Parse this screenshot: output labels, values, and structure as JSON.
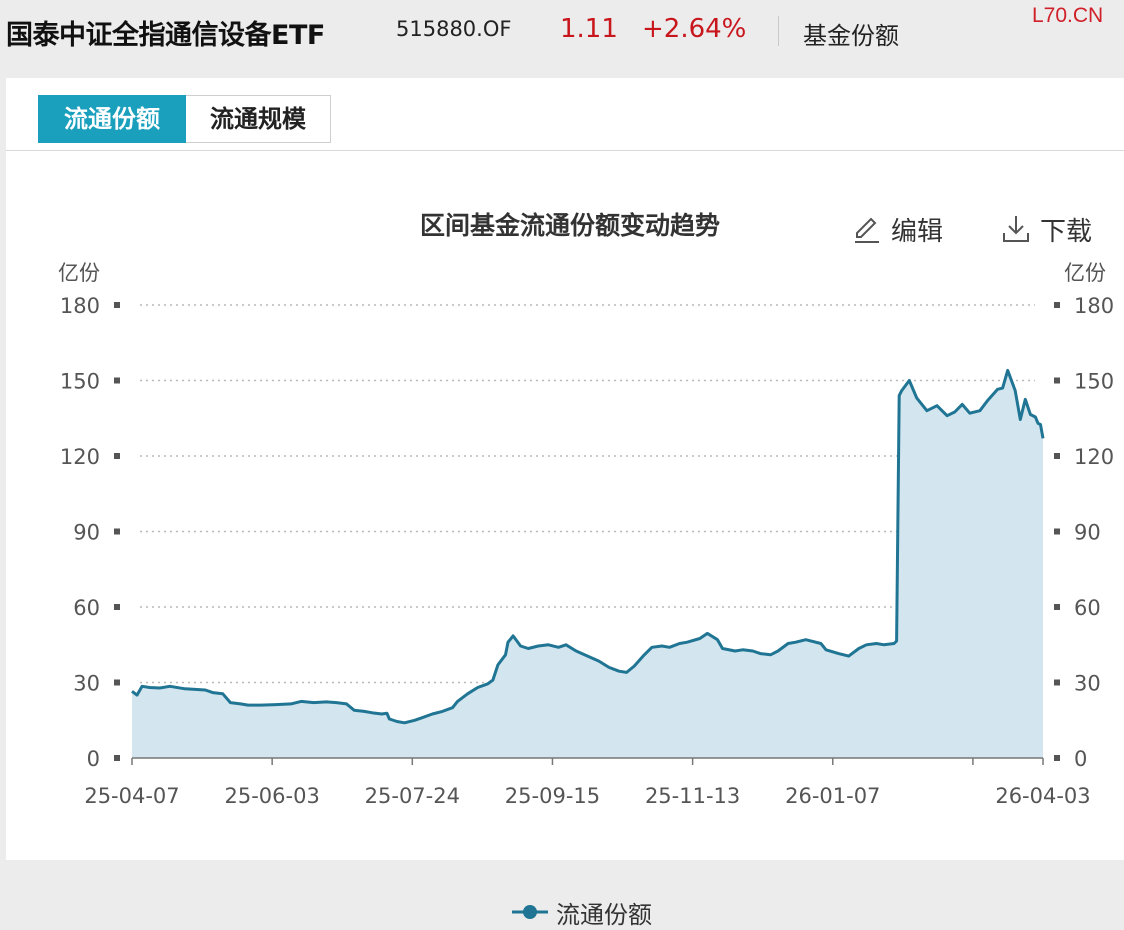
{
  "header": {
    "fund_name": "国泰中证全指通信设备ETF",
    "fund_code": "515880.OF",
    "price": "1.11",
    "change_pct": "+2.64%",
    "section": "基金份额",
    "watermark": "L70.CN"
  },
  "tabs": [
    {
      "label": "流通份额",
      "active": true
    },
    {
      "label": "流通规模",
      "active": false
    }
  ],
  "toolbar": {
    "edit_label": "编辑",
    "download_label": "下载"
  },
  "colors": {
    "line": "#1f7593",
    "area": "#d3e5ee",
    "accent": "#1a9fbd",
    "negative_red": "#c8161d"
  },
  "chart_data": {
    "type": "area",
    "title": "区间基金流通份额变动趋势",
    "y_unit_left": "亿份",
    "y_unit_right": "亿份",
    "ylim": [
      0,
      180
    ],
    "yticks": [
      0,
      30,
      60,
      90,
      120,
      150,
      180
    ],
    "xticks": [
      "25-04-07",
      "25-06-03",
      "25-07-24",
      "25-09-15",
      "25-11-13",
      "26-01-07",
      "26-04-03"
    ],
    "grid": true,
    "legend_position": "bottom-center",
    "series": [
      {
        "name": "流通份额",
        "points": [
          [
            "2025-04-07",
            26.5
          ],
          [
            "2025-04-09",
            25.0
          ],
          [
            "2025-04-11",
            28.5
          ],
          [
            "2025-04-14",
            28.0
          ],
          [
            "2025-04-18",
            27.8
          ],
          [
            "2025-04-22",
            28.5
          ],
          [
            "2025-04-28",
            27.5
          ],
          [
            "2025-05-06",
            27.0
          ],
          [
            "2025-05-09",
            26.0
          ],
          [
            "2025-05-13",
            25.5
          ],
          [
            "2025-05-16",
            22.0
          ],
          [
            "2025-05-20",
            21.5
          ],
          [
            "2025-05-23",
            21.0
          ],
          [
            "2025-05-28",
            21.0
          ],
          [
            "2025-06-03",
            21.2
          ],
          [
            "2025-06-09",
            21.5
          ],
          [
            "2025-06-13",
            22.5
          ],
          [
            "2025-06-18",
            22.0
          ],
          [
            "2025-06-23",
            22.3
          ],
          [
            "2025-06-27",
            22.0
          ],
          [
            "2025-07-01",
            21.5
          ],
          [
            "2025-07-04",
            19.0
          ],
          [
            "2025-07-08",
            18.5
          ],
          [
            "2025-07-11",
            18.0
          ],
          [
            "2025-07-15",
            17.5
          ],
          [
            "2025-07-17",
            17.8
          ],
          [
            "2025-07-18",
            15.5
          ],
          [
            "2025-07-21",
            14.5
          ],
          [
            "2025-07-24",
            14.0
          ],
          [
            "2025-07-28",
            15.0
          ],
          [
            "2025-07-31",
            16.0
          ],
          [
            "2025-08-04",
            17.5
          ],
          [
            "2025-08-08",
            18.5
          ],
          [
            "2025-08-12",
            20.0
          ],
          [
            "2025-08-14",
            22.5
          ],
          [
            "2025-08-18",
            25.5
          ],
          [
            "2025-08-22",
            28.0
          ],
          [
            "2025-08-26",
            29.5
          ],
          [
            "2025-08-28",
            31.0
          ],
          [
            "2025-08-30",
            37.0
          ],
          [
            "2025-09-02",
            41.0
          ],
          [
            "2025-09-03",
            46.0
          ],
          [
            "2025-09-05",
            48.5
          ],
          [
            "2025-09-08",
            44.5
          ],
          [
            "2025-09-11",
            43.5
          ],
          [
            "2025-09-15",
            44.5
          ],
          [
            "2025-09-19",
            45.0
          ],
          [
            "2025-09-23",
            44.0
          ],
          [
            "2025-09-26",
            45.0
          ],
          [
            "2025-09-30",
            42.5
          ],
          [
            "2025-10-09",
            38.5
          ],
          [
            "2025-10-13",
            36.0
          ],
          [
            "2025-10-17",
            34.5
          ],
          [
            "2025-10-20",
            34.0
          ],
          [
            "2025-10-23",
            36.5
          ],
          [
            "2025-10-27",
            41.0
          ],
          [
            "2025-10-30",
            44.0
          ],
          [
            "2025-11-03",
            44.5
          ],
          [
            "2025-11-06",
            44.0
          ],
          [
            "2025-11-10",
            45.5
          ],
          [
            "2025-11-13",
            46.0
          ],
          [
            "2025-11-18",
            47.5
          ],
          [
            "2025-11-21",
            49.5
          ],
          [
            "2025-11-25",
            47.0
          ],
          [
            "2025-11-27",
            43.5
          ],
          [
            "2025-12-02",
            42.5
          ],
          [
            "2025-12-05",
            43.0
          ],
          [
            "2025-12-09",
            42.5
          ],
          [
            "2025-12-12",
            41.5
          ],
          [
            "2025-12-16",
            41.0
          ],
          [
            "2025-12-19",
            42.5
          ],
          [
            "2025-12-23",
            45.5
          ],
          [
            "2025-12-26",
            46.0
          ],
          [
            "2025-12-30",
            47.0
          ],
          [
            "2026-01-05",
            45.5
          ],
          [
            "2026-01-07",
            43.0
          ],
          [
            "2026-01-12",
            41.5
          ],
          [
            "2026-01-16",
            40.5
          ],
          [
            "2026-01-20",
            43.5
          ],
          [
            "2026-01-23",
            45.0
          ],
          [
            "2026-01-27",
            45.5
          ],
          [
            "2026-01-30",
            45.0
          ],
          [
            "2026-02-03",
            45.5
          ],
          [
            "2026-02-04",
            46.5
          ],
          [
            "2026-02-05",
            144.0
          ],
          [
            "2026-02-06",
            146.0
          ],
          [
            "2026-02-09",
            150.0
          ],
          [
            "2026-02-12",
            143.0
          ],
          [
            "2026-02-16",
            138.0
          ],
          [
            "2026-02-20",
            140.0
          ],
          [
            "2026-02-24",
            136.0
          ],
          [
            "2026-02-27",
            137.5
          ],
          [
            "2026-03-02",
            140.5
          ],
          [
            "2026-03-05",
            137.0
          ],
          [
            "2026-03-09",
            138.0
          ],
          [
            "2026-03-12",
            142.0
          ],
          [
            "2026-03-16",
            146.5
          ],
          [
            "2026-03-18",
            147.0
          ],
          [
            "2026-03-20",
            154.0
          ],
          [
            "2026-03-23",
            146.0
          ],
          [
            "2026-03-25",
            134.5
          ],
          [
            "2026-03-27",
            142.5
          ],
          [
            "2026-03-29",
            136.5
          ],
          [
            "2026-03-31",
            135.5
          ],
          [
            "2026-04-01",
            133.0
          ],
          [
            "2026-04-02",
            132.5
          ],
          [
            "2026-04-03",
            127.0
          ]
        ]
      }
    ]
  }
}
